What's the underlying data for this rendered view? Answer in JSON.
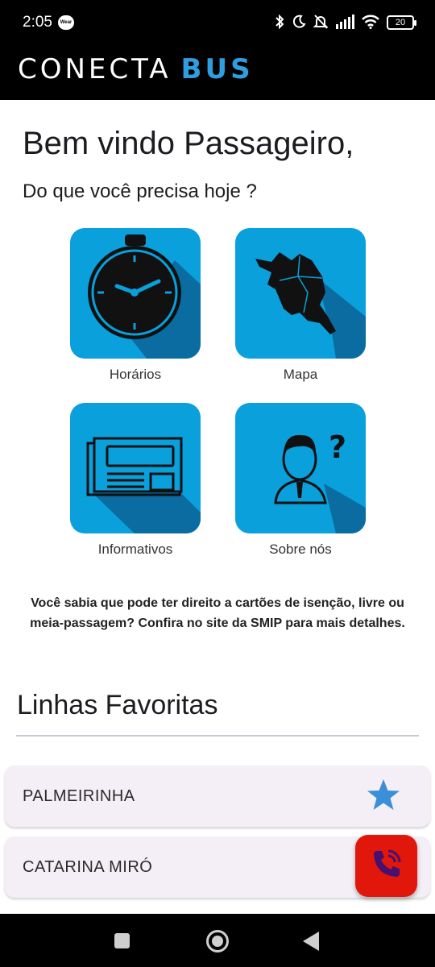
{
  "status_bar": {
    "time": "2:05",
    "wear_badge": "Wear",
    "battery": "20"
  },
  "header": {
    "brand_part1": "CONECTA",
    "brand_part2": "BUS"
  },
  "main": {
    "welcome": "Bem vindo Passageiro,",
    "prompt": "Do que você precisa hoje ?",
    "tiles": [
      {
        "label": "Horários",
        "icon": "stopwatch-icon"
      },
      {
        "label": "Mapa",
        "icon": "map-icon"
      },
      {
        "label": "Informativos",
        "icon": "newspaper-icon"
      },
      {
        "label": "Sobre nós",
        "icon": "person-question-icon"
      }
    ],
    "info_text": "Você sabia que pode ter direito a cartões de isenção, livre ou meia-passagem? Confira no site da SMIP para mais detalhes."
  },
  "favorites": {
    "title": "Linhas Favoritas",
    "items": [
      {
        "name": "PALMEIRINHA",
        "starred": true
      },
      {
        "name": "CATARINA MIRÓ",
        "starred": true
      }
    ]
  },
  "colors": {
    "accent": "#0AA0DC",
    "shadow": "#0A6CA0",
    "fab": "#E0170A",
    "star": "#3A8FD8",
    "header_bg": "#000000"
  },
  "fab": {
    "icon": "phone-call-icon"
  },
  "navbar": {
    "icons": [
      "recents-icon",
      "home-icon",
      "back-icon"
    ]
  }
}
